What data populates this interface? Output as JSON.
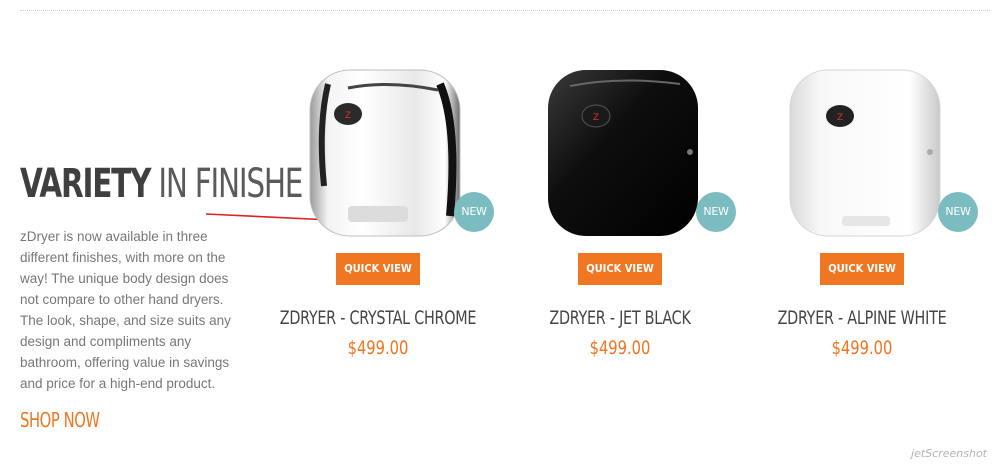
{
  "promo": {
    "heading_strong": "VARIETY",
    "heading_light": "IN FINISHE",
    "body": "zDryer is now available in three different finishes, with more on the way! The unique body design does not compare to other hand dryers. The look, shape, and size suits any design and compliments any bathroom, offering value in savings and price for a high-end product.",
    "cta": "SHOP NOW"
  },
  "products": [
    {
      "name": "ZDRYER - CRYSTAL CHROME",
      "price": "$499.00",
      "badge": "NEW",
      "button": "QUICK VIEW",
      "finish": "chrome"
    },
    {
      "name": "ZDRYER - JET BLACK",
      "price": "$499.00",
      "badge": "NEW",
      "button": "QUICK VIEW",
      "finish": "black"
    },
    {
      "name": "ZDRYER - ALPINE WHITE",
      "price": "$499.00",
      "badge": "NEW",
      "button": "QUICK VIEW",
      "finish": "white"
    }
  ],
  "watermark": "jetScreenshot",
  "colors": {
    "accent": "#f07621",
    "badge": "#7bbcc1",
    "heading": "#4a4a4a",
    "body_text": "#777777",
    "annotation": "#e02020"
  }
}
